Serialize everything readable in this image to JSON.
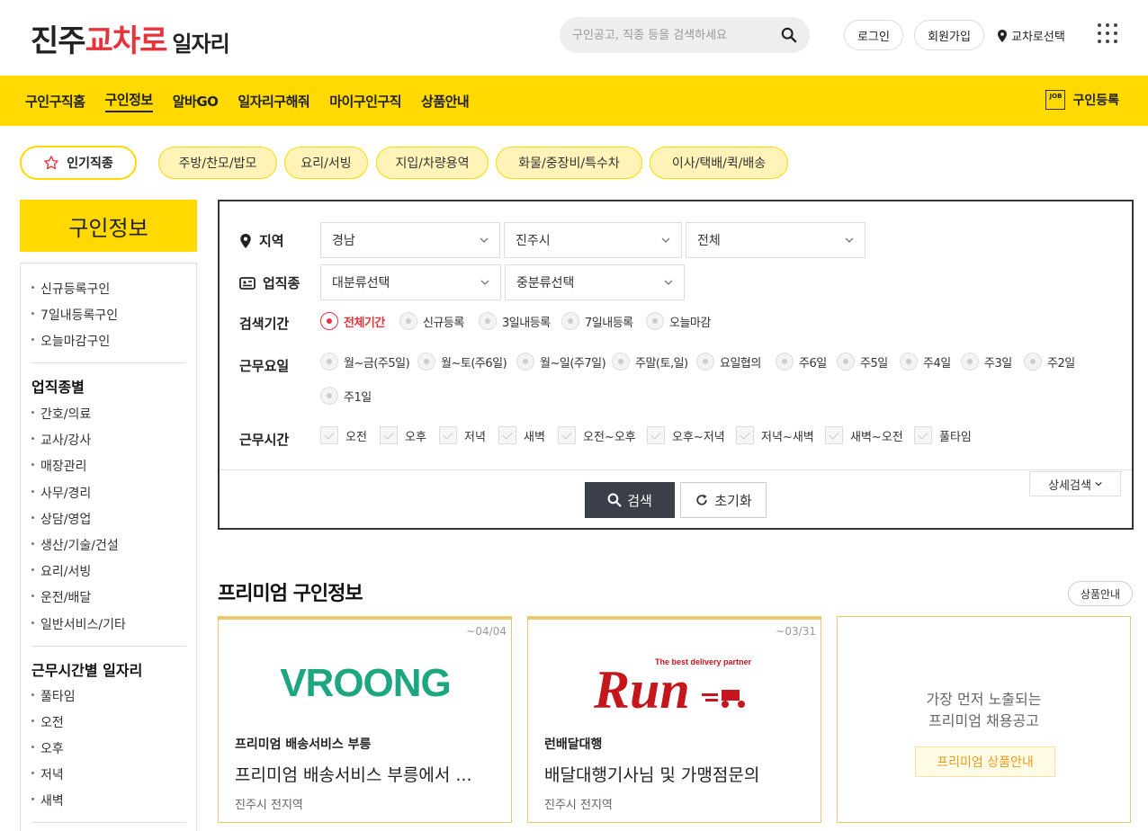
{
  "header": {
    "logo": {
      "part1": "진주",
      "part2": "교차로",
      "part3": "일자리"
    },
    "search_placeholder": "구인공고, 직종 등을 검색하세요",
    "login": "로그인",
    "signup": "회원가입",
    "region_select": "교차로선택"
  },
  "nav": {
    "items": [
      "구인구직홈",
      "구인정보",
      "알바GO",
      "일자리구해줘",
      "마이구인구직",
      "상품안내"
    ],
    "active": "구인정보",
    "register": "구인등록",
    "register_icon_text": "JOB"
  },
  "popular": {
    "label": "인기직종",
    "chips": [
      "주방/찬모/밥모",
      "요리/서빙",
      "지입/차량용역",
      "화물/중장비/특수차",
      "이사/택배/퀵/배송"
    ]
  },
  "sidebar": {
    "title": "구인정보",
    "group1": [
      "신규등록구인",
      "7일내등록구인",
      "오늘마감구인"
    ],
    "group2_title": "업직종별",
    "group2": [
      "간호/의료",
      "교사/강사",
      "매장관리",
      "사무/경리",
      "상담/영업",
      "생산/기술/건설",
      "요리/서빙",
      "운전/배달",
      "일반서비스/기타"
    ],
    "group3_title": "근무시간별 일자리",
    "group3": [
      "풀타임",
      "오전",
      "오후",
      "저녁",
      "새벽"
    ]
  },
  "search": {
    "region_label": "지역",
    "region_values": [
      "경남",
      "진주시",
      "전체"
    ],
    "job_label": "업직종",
    "job_values": [
      "대분류선택",
      "중분류선택"
    ],
    "period_label": "검색기간",
    "period_options": [
      "전체기간",
      "신규등록",
      "3일내등록",
      "7일내등록",
      "오늘마감"
    ],
    "period_selected": "전체기간",
    "day_label": "근무요일",
    "day_options": [
      "월~금(주5일)",
      "월~토(주6일)",
      "월~일(주7일)",
      "주말(토,일)",
      "요일협의",
      "주6일",
      "주5일",
      "주4일",
      "주3일",
      "주2일",
      "주1일"
    ],
    "time_label": "근무시간",
    "time_options": [
      "오전",
      "오후",
      "저녁",
      "새벽",
      "오전~오후",
      "오후~저녁",
      "저녁~새벽",
      "새벽~오전",
      "풀타임"
    ],
    "search_button": "검색",
    "reset_button": "초기화",
    "detail_button": "상세검색"
  },
  "premium": {
    "title": "프리미엄 구인정보",
    "info_button": "상품안내",
    "cards": [
      {
        "date": "~04/04",
        "logo_text": "VROONG",
        "company": "프리미엄 배송서비스 부릉",
        "title": "프리미엄 배송서비스 부릉에서 ...",
        "location": "진주시 전지역"
      },
      {
        "date": "~03/31",
        "logo_text": "Run",
        "logo_sub": "The best delivery partner",
        "company": "런배달대행",
        "title": "배달대행기사님 및 가맹점문의",
        "location": "진주시 전지역"
      }
    ],
    "empty_text1": "가장 먼저 노출되는",
    "empty_text2": "프리미엄 채용공고",
    "empty_button": "프리미엄 상품안내"
  },
  "colors": {
    "brand_yellow": "#ffd900",
    "accent_red": "#e8323c",
    "dark_button": "#3b3f49",
    "card_border": "#e9c96c"
  }
}
